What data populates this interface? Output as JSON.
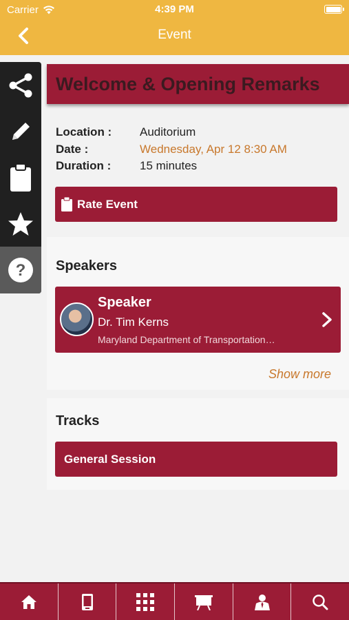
{
  "status_bar": {
    "carrier": "Carrier",
    "time": "4:39 PM"
  },
  "nav": {
    "title": "Event",
    "back_icon": "chevron-left-icon"
  },
  "side_menu": {
    "items": [
      {
        "icon": "share-icon"
      },
      {
        "icon": "pencil-icon"
      },
      {
        "icon": "clipboard-icon"
      },
      {
        "icon": "star-icon"
      },
      {
        "icon": "help-icon"
      }
    ]
  },
  "event": {
    "title": "Welcome & Opening Remarks",
    "location_label": "Location :",
    "location_value": "Auditorium",
    "date_label": "Date :",
    "date_value": "Wednesday, Apr 12 8:30 AM",
    "duration_label": "Duration :",
    "duration_value": "15 minutes",
    "rate_label": "Rate Event"
  },
  "speakers": {
    "header": "Speakers",
    "items": [
      {
        "role": "Speaker",
        "name": "Dr. Tim Kerns",
        "org": "Maryland Department of Transportation…"
      }
    ],
    "show_more": "Show more"
  },
  "tracks": {
    "header": "Tracks",
    "items": [
      {
        "label": "General Session"
      }
    ]
  },
  "tab_bar": {
    "tabs": [
      {
        "icon": "home-icon"
      },
      {
        "icon": "mobile-icon"
      },
      {
        "icon": "grid-icon"
      },
      {
        "icon": "presentation-icon"
      },
      {
        "icon": "attendee-icon"
      },
      {
        "icon": "search-icon"
      }
    ]
  },
  "colors": {
    "nav": "#efb741",
    "accent": "#9b1c36",
    "date": "#c8782c"
  }
}
